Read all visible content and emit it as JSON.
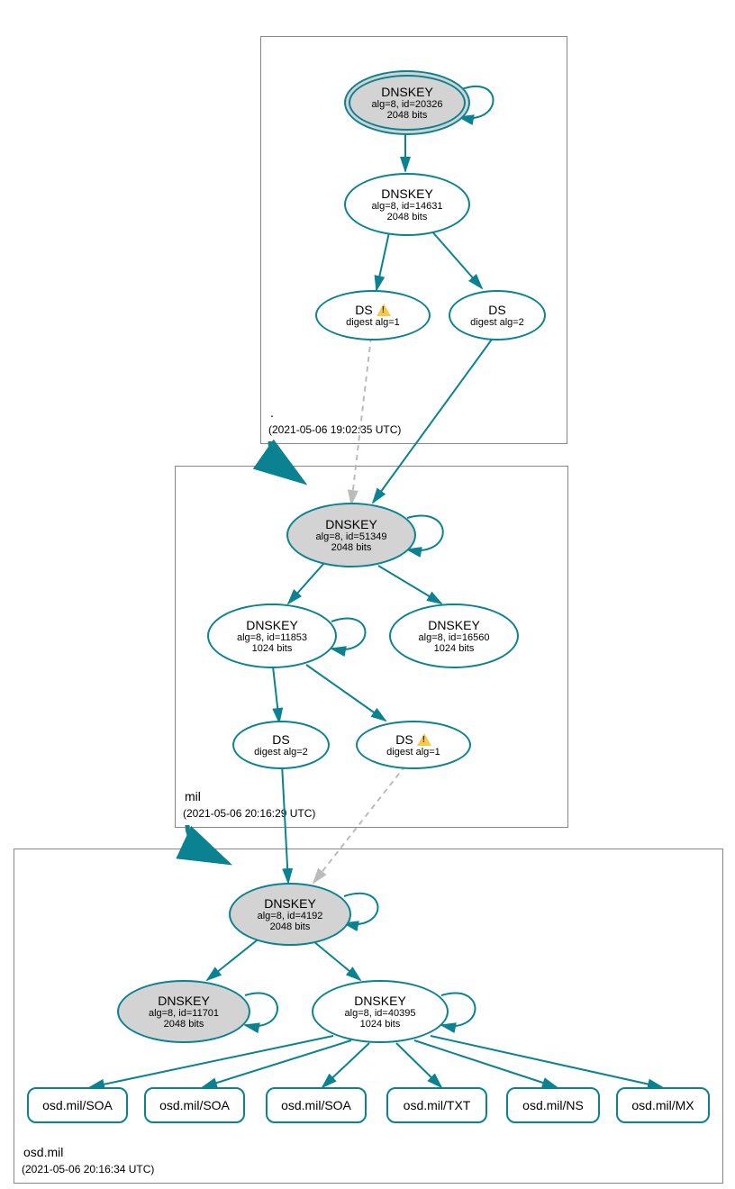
{
  "zones": {
    "root": {
      "name": ".",
      "timestamp": "(2021-05-06 19:02:35 UTC)"
    },
    "mil": {
      "name": "mil",
      "timestamp": "(2021-05-06 20:16:29 UTC)"
    },
    "osd": {
      "name": "osd.mil",
      "timestamp": "(2021-05-06 20:16:34 UTC)"
    }
  },
  "nodes": {
    "root_ksk": {
      "title": "DNSKEY",
      "line1": "alg=8, id=20326",
      "line2": "2048 bits"
    },
    "root_zsk": {
      "title": "DNSKEY",
      "line1": "alg=8, id=14631",
      "line2": "2048 bits"
    },
    "root_ds1": {
      "title": "DS",
      "line1": "digest alg=1"
    },
    "root_ds2": {
      "title": "DS",
      "line1": "digest alg=2"
    },
    "mil_ksk": {
      "title": "DNSKEY",
      "line1": "alg=8, id=51349",
      "line2": "2048 bits"
    },
    "mil_zsk1": {
      "title": "DNSKEY",
      "line1": "alg=8, id=11853",
      "line2": "1024 bits"
    },
    "mil_zsk2": {
      "title": "DNSKEY",
      "line1": "alg=8, id=16560",
      "line2": "1024 bits"
    },
    "mil_ds2": {
      "title": "DS",
      "line1": "digest alg=2"
    },
    "mil_ds1": {
      "title": "DS",
      "line1": "digest alg=1"
    },
    "osd_ksk": {
      "title": "DNSKEY",
      "line1": "alg=8, id=4192",
      "line2": "2048 bits"
    },
    "osd_k2": {
      "title": "DNSKEY",
      "line1": "alg=8, id=11701",
      "line2": "2048 bits"
    },
    "osd_zsk": {
      "title": "DNSKEY",
      "line1": "alg=8, id=40395",
      "line2": "1024 bits"
    },
    "rr1": {
      "title": "osd.mil/SOA"
    },
    "rr2": {
      "title": "osd.mil/SOA"
    },
    "rr3": {
      "title": "osd.mil/SOA"
    },
    "rr4": {
      "title": "osd.mil/TXT"
    },
    "rr5": {
      "title": "osd.mil/NS"
    },
    "rr6": {
      "title": "osd.mil/MX"
    }
  }
}
